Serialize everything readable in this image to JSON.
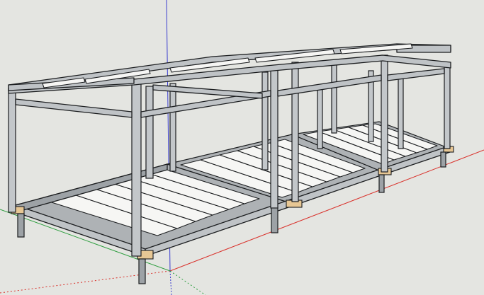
{
  "viewport": {
    "background": "#e4e5e1",
    "axes": {
      "red_axis_color": "#d9302a",
      "green_axis_color": "#2e9e3f",
      "blue_axis_color": "#3a3dcf"
    }
  },
  "model": {
    "description_icon": "steel-frame-structure-icon",
    "colors": {
      "steel": "#bfc3c6",
      "steel_dark": "#9da2a6",
      "plank": "#f6f6f4",
      "pad": "#e7c794",
      "edge": "#1b1d1f"
    },
    "modules": 3
  }
}
